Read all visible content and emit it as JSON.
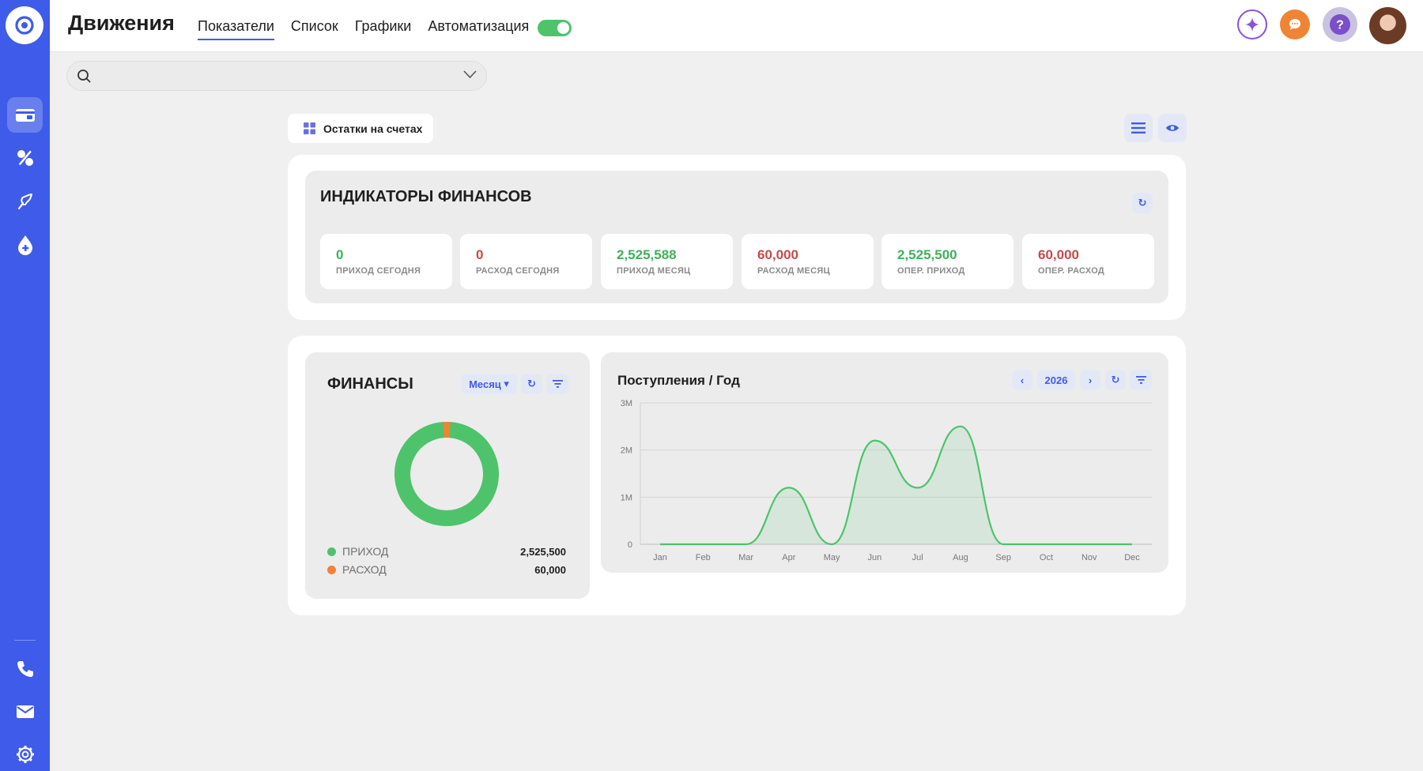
{
  "header": {
    "title": "Движения",
    "tabs": [
      {
        "label": "Показатели",
        "active": true
      },
      {
        "label": "Список",
        "active": false
      },
      {
        "label": "Графики",
        "active": false
      },
      {
        "label": "Автоматизация",
        "active": false
      }
    ],
    "toggle_on": true
  },
  "search": {
    "value": "",
    "placeholder": ""
  },
  "balances_chip": {
    "label": "Остатки на счетах"
  },
  "indicators": {
    "title": "ИНДИКАТОРЫ ФИНАНСОВ",
    "items": [
      {
        "value": "0",
        "label": "ПРИХОД СЕГОДНЯ",
        "tone": "pos"
      },
      {
        "value": "0",
        "label": "РАСХОД СЕГОДНЯ",
        "tone": "neg"
      },
      {
        "value": "2,525,588",
        "label": "ПРИХОД МЕСЯЦ",
        "tone": "pos"
      },
      {
        "value": "60,000",
        "label": "РАСХОД МЕСЯЦ",
        "tone": "neg"
      },
      {
        "value": "2,525,500",
        "label": "ОПЕР. ПРИХОД",
        "tone": "pos"
      },
      {
        "value": "60,000",
        "label": "ОПЕР. РАСХОД",
        "tone": "neg"
      }
    ]
  },
  "finance": {
    "title": "ФИНАНСЫ",
    "period_label": "Месяц",
    "legend": [
      {
        "name": "ПРИХОД",
        "value": "2,525,500"
      },
      {
        "name": "РАСХОД",
        "value": "60,000"
      }
    ]
  },
  "income": {
    "title": "Поступления / Год",
    "year": "2026"
  },
  "colors": {
    "accent": "#3f5be9",
    "income": "#4ec36b",
    "expense": "#ee8434",
    "negative": "#c64a4a"
  },
  "chart_data": [
    {
      "type": "pie",
      "categories": [
        "ПРИХОД",
        "РАСХОД"
      ],
      "values": [
        2525500,
        60000
      ]
    },
    {
      "type": "area",
      "title": "Поступления / Год",
      "categories": [
        "Jan",
        "Feb",
        "Mar",
        "Apr",
        "May",
        "Jun",
        "Jul",
        "Aug",
        "Sep",
        "Oct",
        "Nov",
        "Dec"
      ],
      "values": [
        0,
        0,
        0,
        1200000,
        0,
        2200000,
        1200000,
        2500000,
        0,
        0,
        0,
        0
      ],
      "yticks": [
        "0",
        "1M",
        "2M",
        "3M"
      ],
      "ylim": [
        0,
        3000000
      ],
      "grid": true
    }
  ]
}
